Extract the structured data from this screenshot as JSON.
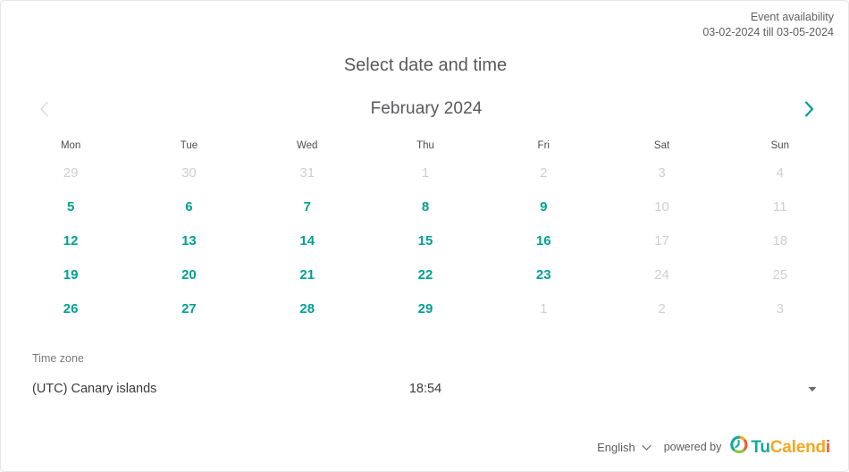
{
  "header": {
    "availability_title": "Event availability",
    "availability_range": "03-02-2024 till 03-05-2024"
  },
  "page_title": "Select date and time",
  "month_nav": {
    "prev_label": "‹",
    "next_label": "›",
    "month_label": "February 2024",
    "prev_enabled": "false",
    "next_enabled": "true",
    "prev_color": "#dcdcdc",
    "next_color": "#00a093"
  },
  "calendar": {
    "weekdays": [
      "Mon",
      "Tue",
      "Wed",
      "Thu",
      "Fri",
      "Sat",
      "Sun"
    ],
    "available_color": "#00a093",
    "disabled_color": "#cfcfcf",
    "weeks": [
      [
        {
          "day": "29",
          "state": "disabled"
        },
        {
          "day": "30",
          "state": "disabled"
        },
        {
          "day": "31",
          "state": "disabled"
        },
        {
          "day": "1",
          "state": "disabled"
        },
        {
          "day": "2",
          "state": "disabled"
        },
        {
          "day": "3",
          "state": "disabled"
        },
        {
          "day": "4",
          "state": "disabled"
        }
      ],
      [
        {
          "day": "5",
          "state": "available"
        },
        {
          "day": "6",
          "state": "available"
        },
        {
          "day": "7",
          "state": "available"
        },
        {
          "day": "8",
          "state": "available"
        },
        {
          "day": "9",
          "state": "available"
        },
        {
          "day": "10",
          "state": "disabled"
        },
        {
          "day": "11",
          "state": "disabled"
        }
      ],
      [
        {
          "day": "12",
          "state": "available"
        },
        {
          "day": "13",
          "state": "available"
        },
        {
          "day": "14",
          "state": "available"
        },
        {
          "day": "15",
          "state": "available"
        },
        {
          "day": "16",
          "state": "available"
        },
        {
          "day": "17",
          "state": "disabled"
        },
        {
          "day": "18",
          "state": "disabled"
        }
      ],
      [
        {
          "day": "19",
          "state": "available"
        },
        {
          "day": "20",
          "state": "available"
        },
        {
          "day": "21",
          "state": "available"
        },
        {
          "day": "22",
          "state": "available"
        },
        {
          "day": "23",
          "state": "available"
        },
        {
          "day": "24",
          "state": "disabled"
        },
        {
          "day": "25",
          "state": "disabled"
        }
      ],
      [
        {
          "day": "26",
          "state": "available"
        },
        {
          "day": "27",
          "state": "available"
        },
        {
          "day": "28",
          "state": "available"
        },
        {
          "day": "29",
          "state": "available"
        },
        {
          "day": "1",
          "state": "disabled"
        },
        {
          "day": "2",
          "state": "disabled"
        },
        {
          "day": "3",
          "state": "disabled"
        }
      ]
    ]
  },
  "timezone": {
    "label": "Time zone",
    "value": "(UTC) Canary islands",
    "time": "18:54",
    "caret_icon": "caret-down-icon"
  },
  "footer": {
    "language": "English",
    "language_caret_icon": "chevron-down-icon",
    "powered_by": "powered by",
    "brand": {
      "mark_icon": "clock-circle-icon",
      "part1": "Tu",
      "part2": "Calend",
      "part3": "i",
      "part1_color": "#13a89e",
      "part2_color": "#f5a623",
      "part3_color": "#ef5b3c"
    }
  }
}
